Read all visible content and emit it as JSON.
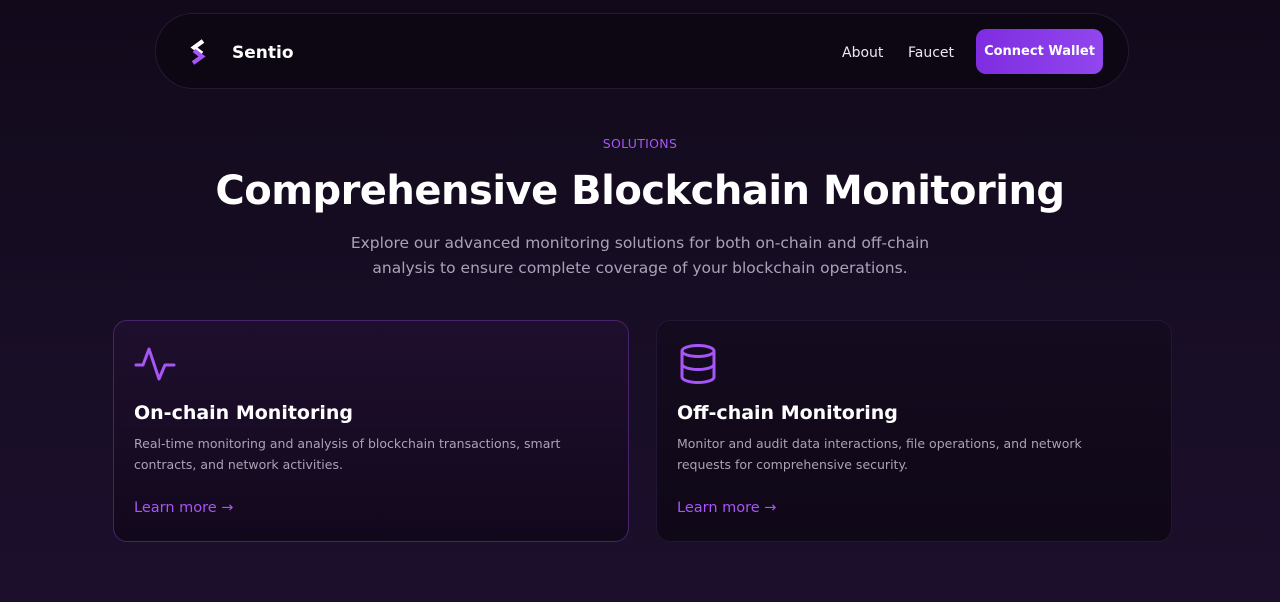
{
  "nav": {
    "brand": "Sentio",
    "links": [
      "About",
      "Faucet"
    ],
    "connect_label": "Connect Wallet"
  },
  "hero": {
    "eyebrow": "SOLUTIONS",
    "title": "Comprehensive Blockchain Monitoring",
    "subtitle": "Explore our advanced monitoring solutions for both on-chain and off-chain analysis to ensure complete coverage of your blockchain operations."
  },
  "cards": [
    {
      "icon": "activity-icon",
      "title": "On-chain Monitoring",
      "description": "Real-time monitoring and analysis of blockchain transactions, smart contracts, and network activities.",
      "link": "Learn more →"
    },
    {
      "icon": "database-icon",
      "title": "Off-chain Monitoring",
      "description": "Monitor and audit data interactions, file operations, and network requests for comprehensive security.",
      "link": "Learn more →"
    }
  ],
  "colors": {
    "accent": "#a855f7",
    "button": "#8b3fea",
    "background": "#170d24"
  }
}
